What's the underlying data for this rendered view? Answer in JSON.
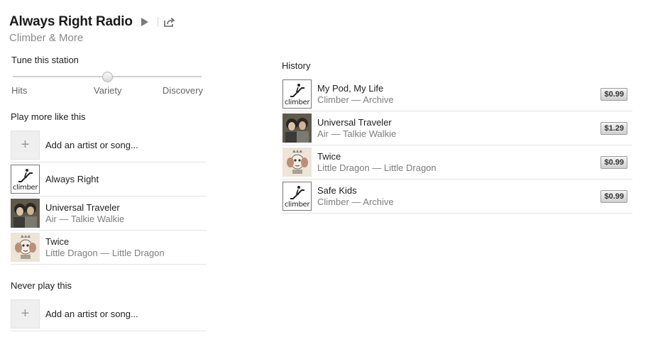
{
  "station": {
    "title": "Always Right Radio",
    "subtitle": "Climber & More"
  },
  "tune": {
    "label": "Tune this station",
    "options": [
      "Hits",
      "Variety",
      "Discovery"
    ],
    "selected": "Variety",
    "level": 0.5
  },
  "play_more": {
    "label": "Play more like this",
    "add_label": "Add an artist or song...",
    "items": [
      {
        "title": "Always Right",
        "subtitle": "",
        "art": "climber-icon"
      },
      {
        "title": "Universal Traveler",
        "subtitle": "Air — Talkie Walkie",
        "art": "air-talkie-walkie-artwork"
      },
      {
        "title": "Twice",
        "subtitle": "Little Dragon — Little Dragon",
        "art": "little-dragon-artwork"
      }
    ]
  },
  "never_play": {
    "label": "Never play this",
    "add_label": "Add an artist or song..."
  },
  "history": {
    "label": "History",
    "items": [
      {
        "title": "My Pod, My Life",
        "subtitle": "Climber — Archive",
        "price": "$0.99",
        "art": "climber-icon"
      },
      {
        "title": "Universal Traveler",
        "subtitle": "Air — Talkie Walkie",
        "price": "$1.29",
        "art": "air-talkie-walkie-artwork"
      },
      {
        "title": "Twice",
        "subtitle": "Little Dragon — Little Dragon",
        "price": "$0.99",
        "art": "little-dragon-artwork"
      },
      {
        "title": "Safe Kids",
        "subtitle": "Climber — Archive",
        "price": "$0.99",
        "art": "climber-icon"
      }
    ]
  },
  "artwork_text": {
    "climber": "climber"
  },
  "icons": {
    "play": "play-icon",
    "share": "share-icon",
    "add": "plus-icon"
  }
}
